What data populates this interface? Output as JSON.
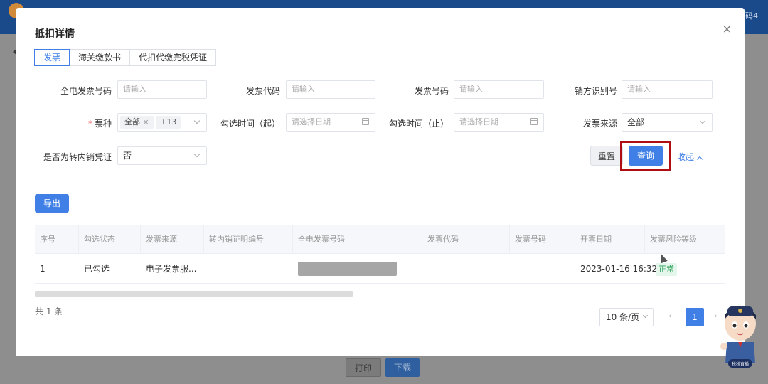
{
  "background": {
    "corner_text": "码4",
    "buttons": {
      "print": "打印",
      "download": "下载"
    }
  },
  "modal": {
    "title": "抵扣详情",
    "tabs": [
      "发票",
      "海关缴款书",
      "代扣代缴完税凭证"
    ],
    "filters": {
      "full_invoice_no": {
        "label": "全电发票号码",
        "placeholder": "请输入"
      },
      "invoice_code": {
        "label": "发票代码",
        "placeholder": "请输入"
      },
      "invoice_no": {
        "label": "发票号码",
        "placeholder": "请输入"
      },
      "seller_tax_id": {
        "label": "销方识别号",
        "placeholder": "请输入"
      },
      "ticket_type": {
        "label": "票种",
        "required_mark": "*",
        "tag_value": "全部",
        "tag_close": "×",
        "more_count": "+13"
      },
      "select_time_start": {
        "label": "勾选时间（起）",
        "placeholder": "请选择日期"
      },
      "select_time_end": {
        "label": "勾选时间（止）",
        "placeholder": "请选择日期"
      },
      "invoice_source": {
        "label": "发票来源",
        "value": "全部"
      },
      "is_transfer_out": {
        "label": "是否为转内销凭证",
        "value": "否"
      }
    },
    "actions": {
      "reset": "重置",
      "query": "查询",
      "collapse": "收起"
    },
    "export_button": "导出",
    "table": {
      "columns": [
        "序号",
        "勾选状态",
        "发票来源",
        "转内销证明编号",
        "全电发票号码",
        "发票代码",
        "发票号码",
        "开票日期",
        "发票风险等级"
      ],
      "rows": [
        {
          "index": "1",
          "select_status": "已勾选",
          "source": "电子发票服...",
          "transfer_no": "",
          "full_invoice_no": "",
          "invoice_code": "",
          "invoice_no": "",
          "issue_date": "2023-01-16 16:32",
          "risk_level": "正常"
        }
      ]
    },
    "pagination": {
      "total": "共 1 条",
      "page_size": "10 条/页",
      "prev": "‹",
      "current_page": "1",
      "next": "›"
    }
  },
  "colors": {
    "primary": "#3f7fe6",
    "highlight": "#b00d12",
    "success_bg": "#e5f7ec",
    "success_text": "#2ea15a"
  },
  "mascot": {
    "badge_text": "税税直播"
  }
}
